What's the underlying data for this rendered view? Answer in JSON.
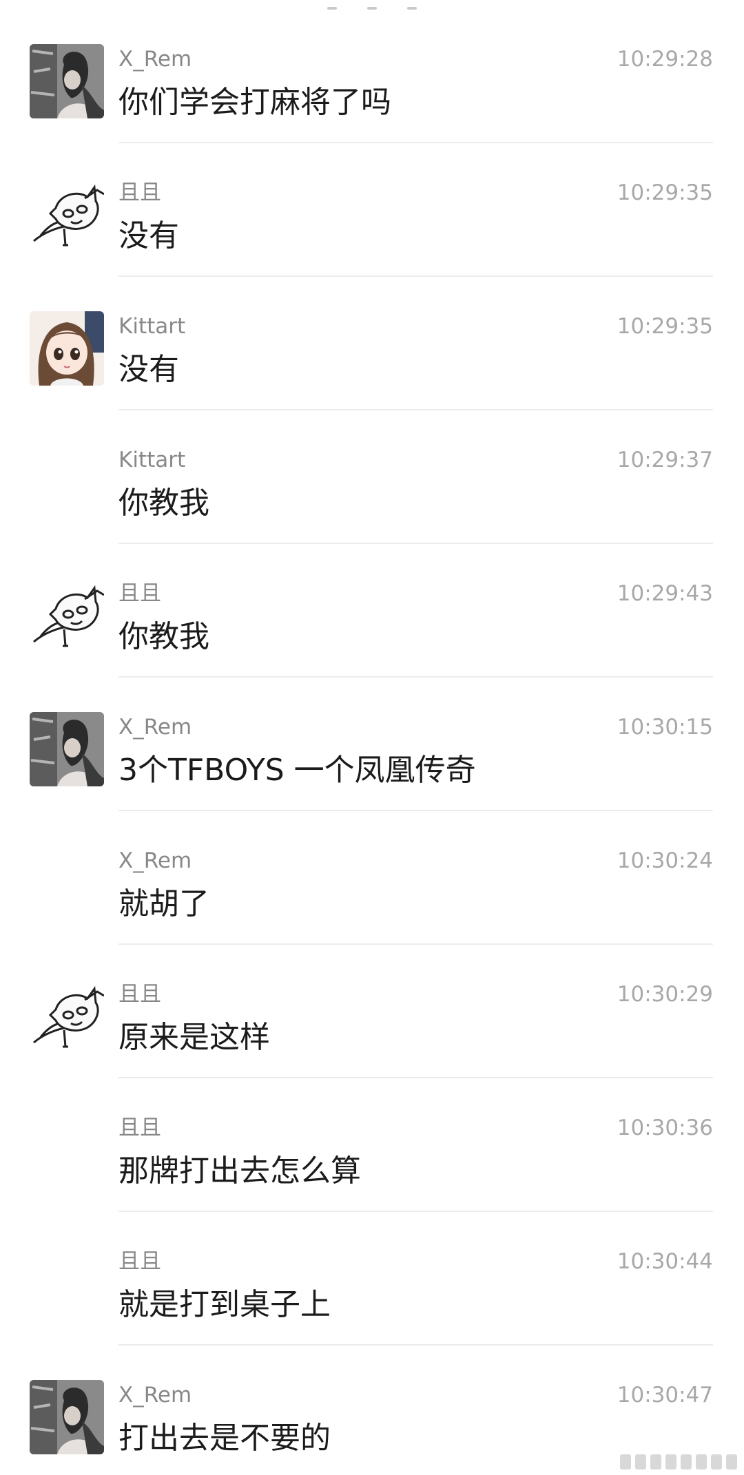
{
  "messages": [
    {
      "avatar": "x-rem",
      "name": "X_Rem",
      "time": "10:29:28",
      "text": "你们学会打麻将了吗"
    },
    {
      "avatar": "cat",
      "name": "且且",
      "time": "10:29:35",
      "text": "没有"
    },
    {
      "avatar": "kittart",
      "name": "Kittart",
      "time": "10:29:35",
      "text": "没有"
    },
    {
      "avatar": "none",
      "name": "Kittart",
      "time": "10:29:37",
      "text": "你教我"
    },
    {
      "avatar": "cat",
      "name": "且且",
      "time": "10:29:43",
      "text": "你教我"
    },
    {
      "avatar": "x-rem",
      "name": "X_Rem",
      "time": "10:30:15",
      "text": "3个TFBOYS 一个凤凰传奇"
    },
    {
      "avatar": "none",
      "name": "X_Rem",
      "time": "10:30:24",
      "text": "就胡了"
    },
    {
      "avatar": "cat",
      "name": "且且",
      "time": "10:30:29",
      "text": "原来是这样"
    },
    {
      "avatar": "none",
      "name": "且且",
      "time": "10:30:36",
      "text": "那牌打出去怎么算"
    },
    {
      "avatar": "none",
      "name": "且且",
      "time": "10:30:44",
      "text": "就是打到桌子上"
    },
    {
      "avatar": "x-rem",
      "name": "X_Rem",
      "time": "10:30:47",
      "text": "打出去是不要的"
    }
  ]
}
